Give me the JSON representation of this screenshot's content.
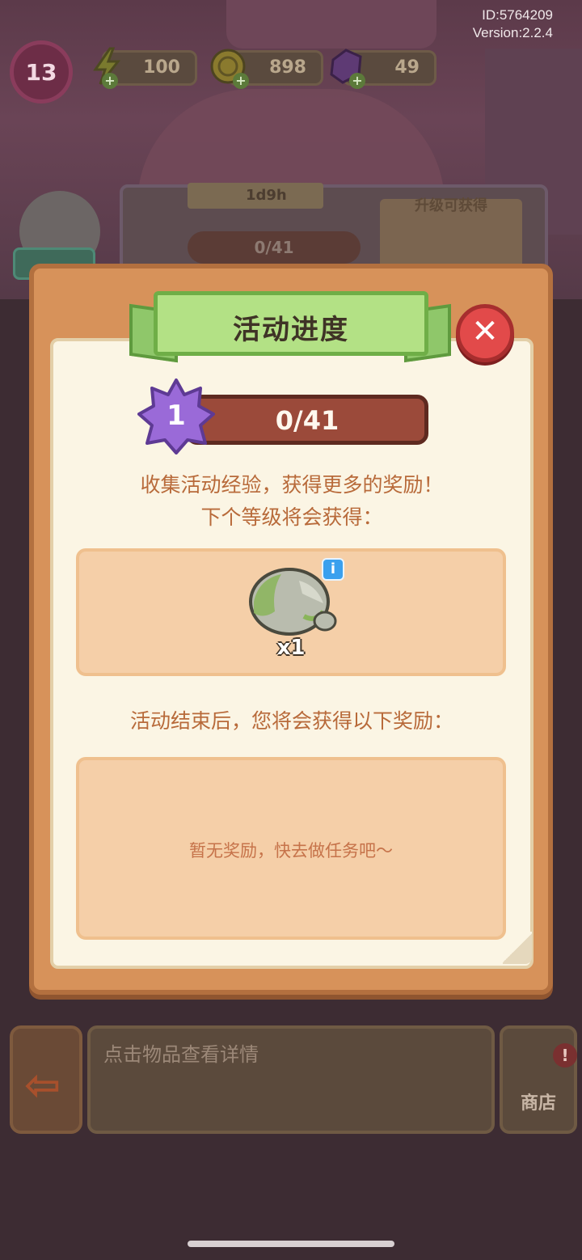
{
  "header": {
    "player_id": "ID:5764209",
    "version": "Version:2.2.4",
    "player_level": "13",
    "energy": "100",
    "coins": "898",
    "gems": "49"
  },
  "background_panel": {
    "timer": "1d9h",
    "progress": "0/41",
    "reward_title": "升级可获得"
  },
  "modal": {
    "title": "活动进度",
    "close_icon": "close-icon",
    "level": "1",
    "progress_text": "0/41",
    "progress_fraction": 0,
    "desc_line1": "收集活动经验，获得更多的奖励！",
    "desc_line2": "下个等级将会获得：",
    "next_reward": {
      "icon": "stone-icon",
      "quantity": "x1",
      "info": "i"
    },
    "end_desc": "活动结束后，您将会获得以下奖励：",
    "end_empty": "暂无奖励，快去做任务吧～"
  },
  "bottom_bar": {
    "detail_placeholder": "点击物品查看详情",
    "shop_label": "商店",
    "shop_alert": "!"
  },
  "colors": {
    "modal_frame": "#d7925a",
    "ribbon": "#b3e185",
    "close_red": "#e24a4a",
    "progress_bar": "#9b4a3a",
    "star_purple": "#9a6ad8",
    "text_orange": "#b86a3a",
    "reward_bg": "#f5cfa8"
  }
}
